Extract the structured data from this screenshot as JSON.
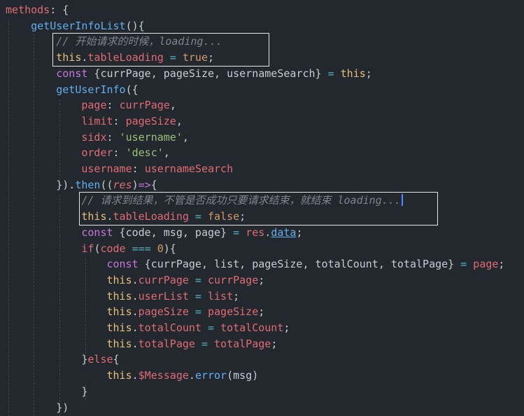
{
  "editor": {
    "lines": [
      [
        {
          "t": "methods",
          "c": "kw"
        },
        {
          "t": ": {",
          "c": "pl"
        }
      ],
      [
        {
          "t": "    ",
          "c": "pl"
        },
        {
          "t": "getUserInfoList",
          "c": "fn"
        },
        {
          "t": "(){",
          "c": "pl"
        }
      ],
      [
        {
          "t": "        ",
          "c": "pl"
        },
        {
          "t": "// 开始请求的时候，loading...",
          "c": "cm"
        }
      ],
      [
        {
          "t": "        ",
          "c": "pl"
        },
        {
          "t": "this",
          "c": "th"
        },
        {
          "t": ".",
          "c": "pl"
        },
        {
          "t": "tableLoading",
          "c": "pr"
        },
        {
          "t": " = ",
          "c": "op"
        },
        {
          "t": "true",
          "c": "num"
        },
        {
          "t": ";",
          "c": "pl"
        }
      ],
      [
        {
          "t": "        ",
          "c": "pl"
        },
        {
          "t": "const",
          "c": "dt"
        },
        {
          "t": " {currPage, pageSize, usernameSearch} ",
          "c": "pl"
        },
        {
          "t": "=",
          "c": "op"
        },
        {
          "t": " ",
          "c": "pl"
        },
        {
          "t": "this",
          "c": "th"
        },
        {
          "t": ";",
          "c": "pl"
        }
      ],
      [
        {
          "t": "        ",
          "c": "pl"
        },
        {
          "t": "getUserInfo",
          "c": "fn"
        },
        {
          "t": "({",
          "c": "pl"
        }
      ],
      [
        {
          "t": "            ",
          "c": "pl"
        },
        {
          "t": "page",
          "c": "pr"
        },
        {
          "t": ": ",
          "c": "pl"
        },
        {
          "t": "currPage",
          "c": "vr"
        },
        {
          "t": ",",
          "c": "pl"
        }
      ],
      [
        {
          "t": "            ",
          "c": "pl"
        },
        {
          "t": "limit",
          "c": "pr"
        },
        {
          "t": ": ",
          "c": "pl"
        },
        {
          "t": "pageSize",
          "c": "vr"
        },
        {
          "t": ",",
          "c": "pl"
        }
      ],
      [
        {
          "t": "            ",
          "c": "pl"
        },
        {
          "t": "sidx",
          "c": "pr"
        },
        {
          "t": ": ",
          "c": "pl"
        },
        {
          "t": "'username'",
          "c": "str"
        },
        {
          "t": ",",
          "c": "pl"
        }
      ],
      [
        {
          "t": "            ",
          "c": "pl"
        },
        {
          "t": "order",
          "c": "pr"
        },
        {
          "t": ": ",
          "c": "pl"
        },
        {
          "t": "'desc'",
          "c": "str"
        },
        {
          "t": ",",
          "c": "pl"
        }
      ],
      [
        {
          "t": "            ",
          "c": "pl"
        },
        {
          "t": "username",
          "c": "pr"
        },
        {
          "t": ": ",
          "c": "pl"
        },
        {
          "t": "usernameSearch",
          "c": "vr"
        }
      ],
      [
        {
          "t": "        ",
          "c": "pl"
        },
        {
          "t": "}).",
          "c": "pl"
        },
        {
          "t": "then",
          "c": "fn"
        },
        {
          "t": "((",
          "c": "pl"
        },
        {
          "t": "res",
          "c": "it"
        },
        {
          "t": ")",
          "c": "pl"
        },
        {
          "t": "=>",
          "c": "dt"
        },
        {
          "t": "{",
          "c": "pl"
        }
      ],
      [
        {
          "t": "            ",
          "c": "pl"
        },
        {
          "t": "// 请求到结果，不管是否成功只要请求结束，就结束 loading...",
          "c": "cm"
        }
      ],
      [
        {
          "t": "            ",
          "c": "pl"
        },
        {
          "t": "this",
          "c": "th"
        },
        {
          "t": ".",
          "c": "pl"
        },
        {
          "t": "tableLoading",
          "c": "pr"
        },
        {
          "t": " = ",
          "c": "op"
        },
        {
          "t": "false",
          "c": "num"
        },
        {
          "t": ";",
          "c": "pl"
        }
      ],
      [
        {
          "t": "            ",
          "c": "pl"
        },
        {
          "t": "const",
          "c": "dt"
        },
        {
          "t": " {code, msg, page} ",
          "c": "pl"
        },
        {
          "t": "=",
          "c": "op"
        },
        {
          "t": " ",
          "c": "pl"
        },
        {
          "t": "res",
          "c": "vr"
        },
        {
          "t": ".",
          "c": "pl"
        },
        {
          "t": "data",
          "c": "ln"
        },
        {
          "t": ";",
          "c": "pl"
        }
      ],
      [
        {
          "t": "            ",
          "c": "pl"
        },
        {
          "t": "if",
          "c": "kw"
        },
        {
          "t": "(",
          "c": "pl"
        },
        {
          "t": "code",
          "c": "vr"
        },
        {
          "t": " === ",
          "c": "op"
        },
        {
          "t": "0",
          "c": "num"
        },
        {
          "t": "){",
          "c": "pl"
        }
      ],
      [
        {
          "t": "                ",
          "c": "pl"
        },
        {
          "t": "const",
          "c": "dt"
        },
        {
          "t": " {currPage, list, pageSize, totalCount, totalPage} ",
          "c": "pl"
        },
        {
          "t": "=",
          "c": "op"
        },
        {
          "t": " ",
          "c": "pl"
        },
        {
          "t": "page",
          "c": "vr"
        },
        {
          "t": ";",
          "c": "pl"
        }
      ],
      [
        {
          "t": "                ",
          "c": "pl"
        },
        {
          "t": "this",
          "c": "th"
        },
        {
          "t": ".",
          "c": "pl"
        },
        {
          "t": "currPage",
          "c": "pr"
        },
        {
          "t": " = ",
          "c": "op"
        },
        {
          "t": "currPage",
          "c": "vr"
        },
        {
          "t": ";",
          "c": "pl"
        }
      ],
      [
        {
          "t": "                ",
          "c": "pl"
        },
        {
          "t": "this",
          "c": "th"
        },
        {
          "t": ".",
          "c": "pl"
        },
        {
          "t": "userList",
          "c": "pr"
        },
        {
          "t": " = ",
          "c": "op"
        },
        {
          "t": "list",
          "c": "vr"
        },
        {
          "t": ";",
          "c": "pl"
        }
      ],
      [
        {
          "t": "                ",
          "c": "pl"
        },
        {
          "t": "this",
          "c": "th"
        },
        {
          "t": ".",
          "c": "pl"
        },
        {
          "t": "pageSize",
          "c": "pr"
        },
        {
          "t": " = ",
          "c": "op"
        },
        {
          "t": "pageSize",
          "c": "vr"
        },
        {
          "t": ";",
          "c": "pl"
        }
      ],
      [
        {
          "t": "                ",
          "c": "pl"
        },
        {
          "t": "this",
          "c": "th"
        },
        {
          "t": ".",
          "c": "pl"
        },
        {
          "t": "totalCount",
          "c": "pr"
        },
        {
          "t": " = ",
          "c": "op"
        },
        {
          "t": "totalCount",
          "c": "vr"
        },
        {
          "t": ";",
          "c": "pl"
        }
      ],
      [
        {
          "t": "                ",
          "c": "pl"
        },
        {
          "t": "this",
          "c": "th"
        },
        {
          "t": ".",
          "c": "pl"
        },
        {
          "t": "totalPage",
          "c": "pr"
        },
        {
          "t": " = ",
          "c": "op"
        },
        {
          "t": "totalPage",
          "c": "vr"
        },
        {
          "t": ";",
          "c": "pl"
        }
      ],
      [
        {
          "t": "            ",
          "c": "pl"
        },
        {
          "t": "}",
          "c": "pl"
        },
        {
          "t": "else",
          "c": "kw"
        },
        {
          "t": "{",
          "c": "pl"
        }
      ],
      [
        {
          "t": "                ",
          "c": "pl"
        },
        {
          "t": "this",
          "c": "th"
        },
        {
          "t": ".",
          "c": "pl"
        },
        {
          "t": "$Message",
          "c": "pr"
        },
        {
          "t": ".",
          "c": "pl"
        },
        {
          "t": "error",
          "c": "fn"
        },
        {
          "t": "(",
          "c": "pl"
        },
        {
          "t": "msg",
          "c": "pl"
        },
        {
          "t": ")",
          "c": "pl"
        }
      ],
      [
        {
          "t": "            ",
          "c": "pl"
        },
        {
          "t": "}",
          "c": "pl"
        }
      ],
      [
        {
          "t": "        ",
          "c": "pl"
        },
        {
          "t": "})",
          "c": "pl"
        }
      ]
    ],
    "cursor_line": 12,
    "highlight_boxes": [
      {
        "first_line": 2,
        "last_line": 3
      },
      {
        "first_line": 12,
        "last_line": 13
      }
    ]
  }
}
